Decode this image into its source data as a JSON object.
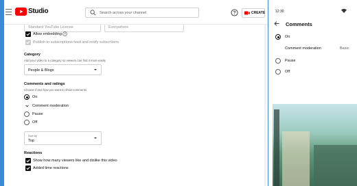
{
  "studio": {
    "logo_text": "Studio",
    "search_placeholder": "Search across your channel",
    "create_label": "CREATE",
    "license_value": "Standard YouTube License",
    "distribution_value": "Everywhere",
    "allow_embedding_label": "Allow embedding",
    "publish_feed_label": "Publish to subscriptions feed and notify subscribers",
    "category": {
      "title": "Category",
      "subtitle": "Add your video to a category so viewers can find it more easily",
      "value": "People & Blogs"
    },
    "comments": {
      "title": "Comments and ratings",
      "subtitle": "Choose if and how you want to show comments",
      "options": [
        {
          "label": "On",
          "selected": true
        },
        {
          "label": "Comment moderation",
          "selected": false
        },
        {
          "label": "Pause",
          "selected": false
        },
        {
          "label": "Off",
          "selected": false
        }
      ],
      "sort_label": "Sort by",
      "sort_value": "Top"
    },
    "reactions": {
      "title": "Reactions",
      "show_likes_label": "Show how many viewers like and dislike this video",
      "time_reactions_label": "Added time reactions"
    }
  },
  "mobile": {
    "time": "12:30",
    "title": "Comments",
    "options": [
      {
        "label": "On",
        "selected": true
      },
      {
        "label": "Pause",
        "selected": false
      },
      {
        "label": "Off",
        "selected": false
      }
    ],
    "moderation_label": "Comment moderation",
    "moderation_value": "Basic"
  },
  "colors": {
    "background": "#3a8ad8",
    "youtube_red": "#ff0000",
    "text": "#0d0d0d"
  }
}
